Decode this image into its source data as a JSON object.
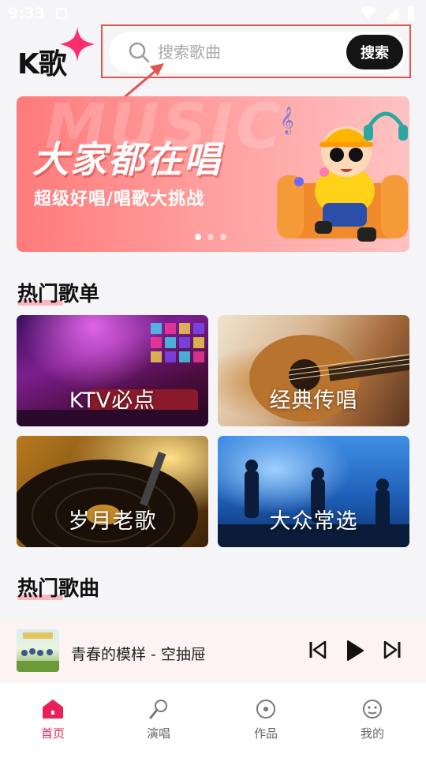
{
  "status_bar": {
    "time": "9:33"
  },
  "header": {
    "logo": "K歌",
    "search_placeholder": "搜索歌曲",
    "search_button": "搜索"
  },
  "banner": {
    "bg_text": "MUSIC",
    "title": "大家都在唱",
    "subtitle": "超级好唱/唱歌大挑战",
    "page_count": 3,
    "active_page": 0
  },
  "hot_playlists": {
    "title": "热门歌单",
    "items": [
      {
        "label": "KTV必点"
      },
      {
        "label": "经典传唱"
      },
      {
        "label": "岁月老歌"
      },
      {
        "label": "大众常选"
      }
    ]
  },
  "hot_songs": {
    "title": "热门歌曲"
  },
  "player": {
    "song": "青春的模样 - 空抽屉"
  },
  "tabs": [
    {
      "label": "首页",
      "icon": "home-icon",
      "active": true
    },
    {
      "label": "演唱",
      "icon": "microphone-icon",
      "active": false
    },
    {
      "label": "作品",
      "icon": "disc-icon",
      "active": false
    },
    {
      "label": "我的",
      "icon": "profile-icon",
      "active": false
    }
  ],
  "colors": {
    "accent": "#e8215a",
    "annotation": "#e0564f",
    "search_button_bg": "#141414"
  }
}
